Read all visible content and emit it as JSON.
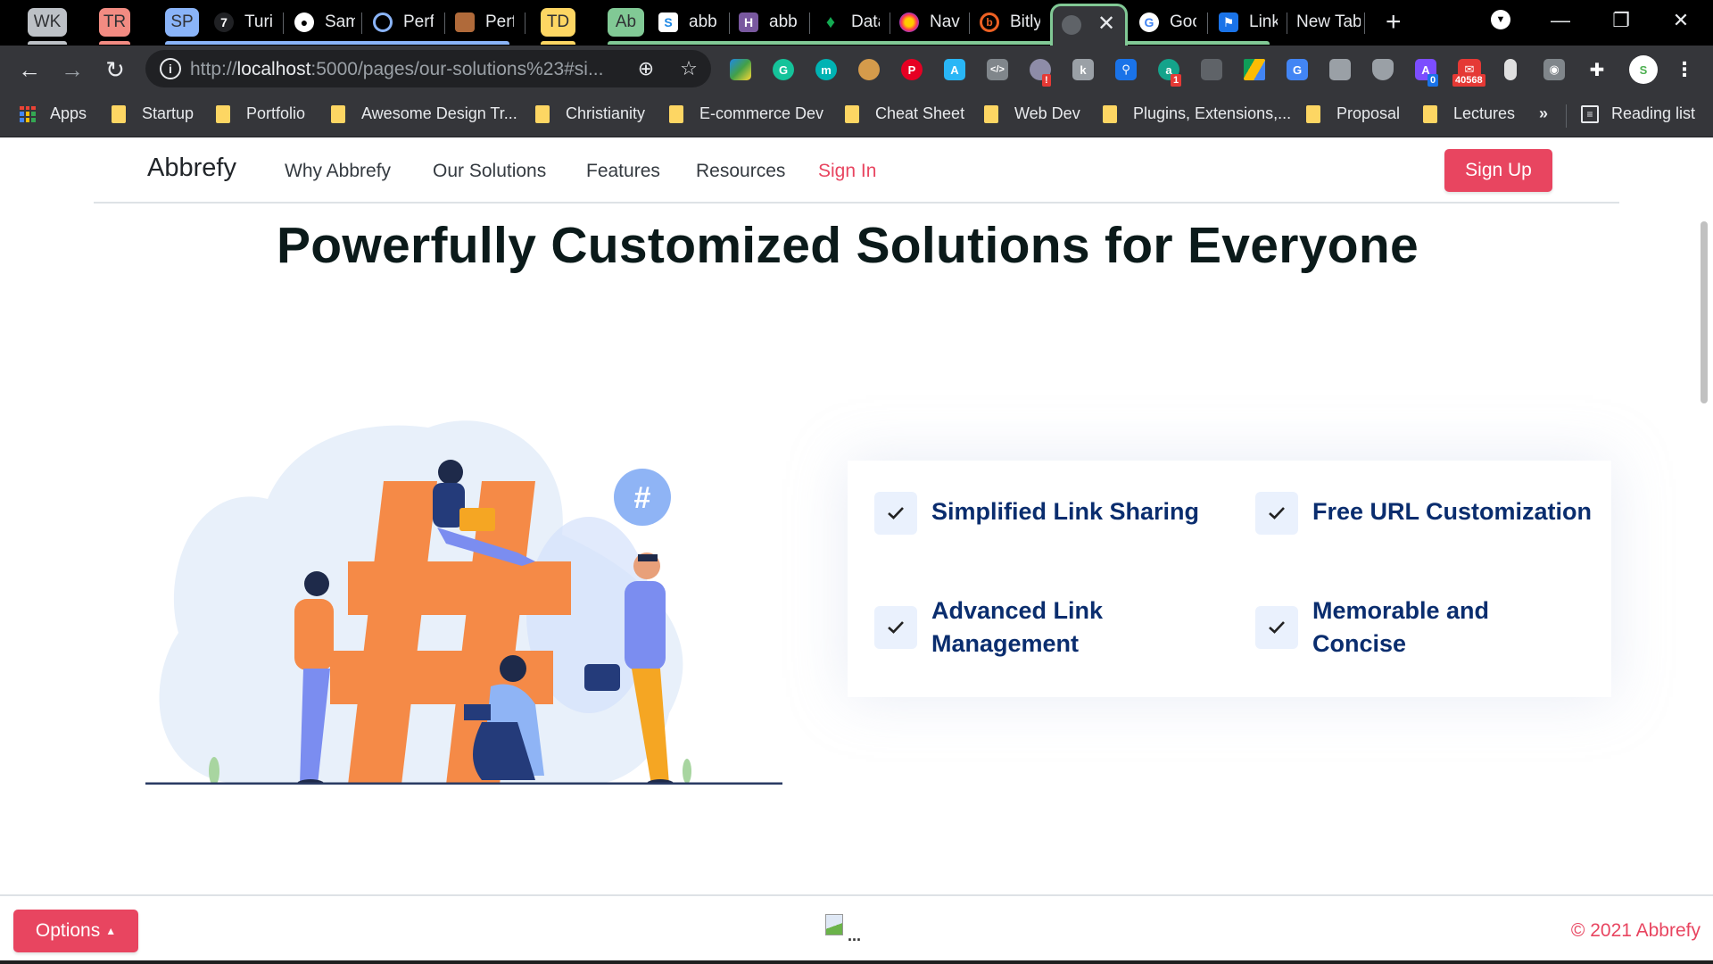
{
  "browser": {
    "tab_groups": [
      {
        "label": "WK",
        "color": "#bdc1c6"
      },
      {
        "label": "TR",
        "color": "#f28b82"
      },
      {
        "label": "SP",
        "color": "#8ab4f8"
      },
      {
        "label": "TD",
        "color": "#fdd663"
      },
      {
        "label": "Ab",
        "color": "#81c995"
      }
    ],
    "tabs": [
      {
        "label": "Turi",
        "icon": "turing-icon"
      },
      {
        "label": "Sam",
        "icon": "github-icon"
      },
      {
        "label": "Perf",
        "icon": "perf-icon"
      },
      {
        "label": "Perf",
        "icon": "photo-icon"
      },
      {
        "label": "abb",
        "icon": "s-icon"
      },
      {
        "label": "abb",
        "icon": "heroku-icon"
      },
      {
        "label": "Data",
        "icon": "mongodb-leaf-icon"
      },
      {
        "label": "Nav",
        "icon": "firefox-icon"
      },
      {
        "label": "Bitly",
        "icon": "bitly-icon"
      },
      {
        "label": "",
        "icon": "globe-icon",
        "active": true
      },
      {
        "label": "Goo",
        "icon": "google-icon"
      },
      {
        "label": "Link",
        "icon": "flag-icon"
      },
      {
        "label": "New Tab",
        "icon": ""
      }
    ],
    "new_tab_symbol": "+",
    "url": {
      "scheme": "http://",
      "host": "localhost",
      "rest": ":5000/pages/our-solutions%23#si..."
    },
    "extension_badges": {
      "alert": "!",
      "count_a": "1",
      "count_purple": "0",
      "mail": "40568"
    },
    "bookmarks": [
      "Startup",
      "Portfolio",
      "Awesome Design Tr...",
      "Christianity",
      "E-commerce Dev",
      "Cheat Sheet",
      "Web Dev",
      "Plugins, Extensions,...",
      "Proposal",
      "Lectures"
    ],
    "apps_label": "Apps",
    "overflow_label": "»",
    "reading_list_label": "Reading list"
  },
  "site": {
    "brand": "Abbrefy",
    "nav": [
      "Why Abbrefy",
      "Our Solutions",
      "Features",
      "Resources"
    ],
    "sign_in": "Sign In",
    "sign_up": "Sign Up",
    "accent_color": "#e84560",
    "hero_title": "Powerfully Customized Solutions for Everyone",
    "features": [
      "Simplified Link Sharing",
      "Free URL Customization",
      "Advanced Link Management",
      "Memorable and Concise"
    ],
    "footer": {
      "options_label": "Options",
      "options_caret": "▲",
      "broken_img_alt": "...",
      "copyright": "© 2021 Abbrefy"
    }
  }
}
